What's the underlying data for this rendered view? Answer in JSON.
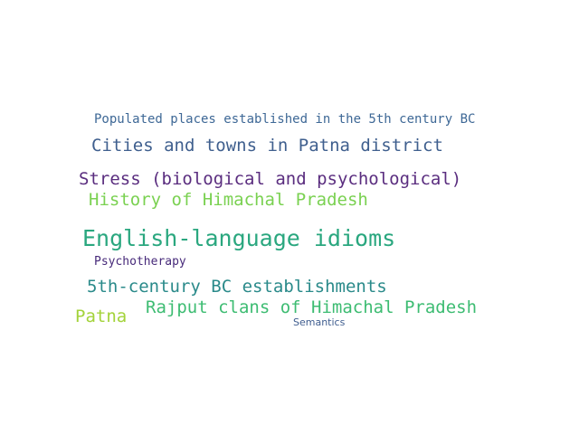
{
  "words": [
    {
      "text": "Populated places established in the 5th century BC",
      "color": "#3e6896"
    },
    {
      "text": "Cities and towns in Patna district",
      "color": "#3f5f8e"
    },
    {
      "text": "Stress (biological and psychological)",
      "color": "#5a2d7f"
    },
    {
      "text": "History of Himachal Pradesh",
      "color": "#7ad151"
    },
    {
      "text": "English-language idioms",
      "color": "#2aa77f"
    },
    {
      "text": "Psychotherapy",
      "color": "#472a7a"
    },
    {
      "text": "5th-century BC establishments",
      "color": "#2a8a8a"
    },
    {
      "text": "Patna",
      "color": "#a3d33a"
    },
    {
      "text": "Rajput clans of Himachal Pradesh",
      "color": "#3dbc72"
    },
    {
      "text": "Semantics",
      "color": "#3f5d8f"
    }
  ]
}
